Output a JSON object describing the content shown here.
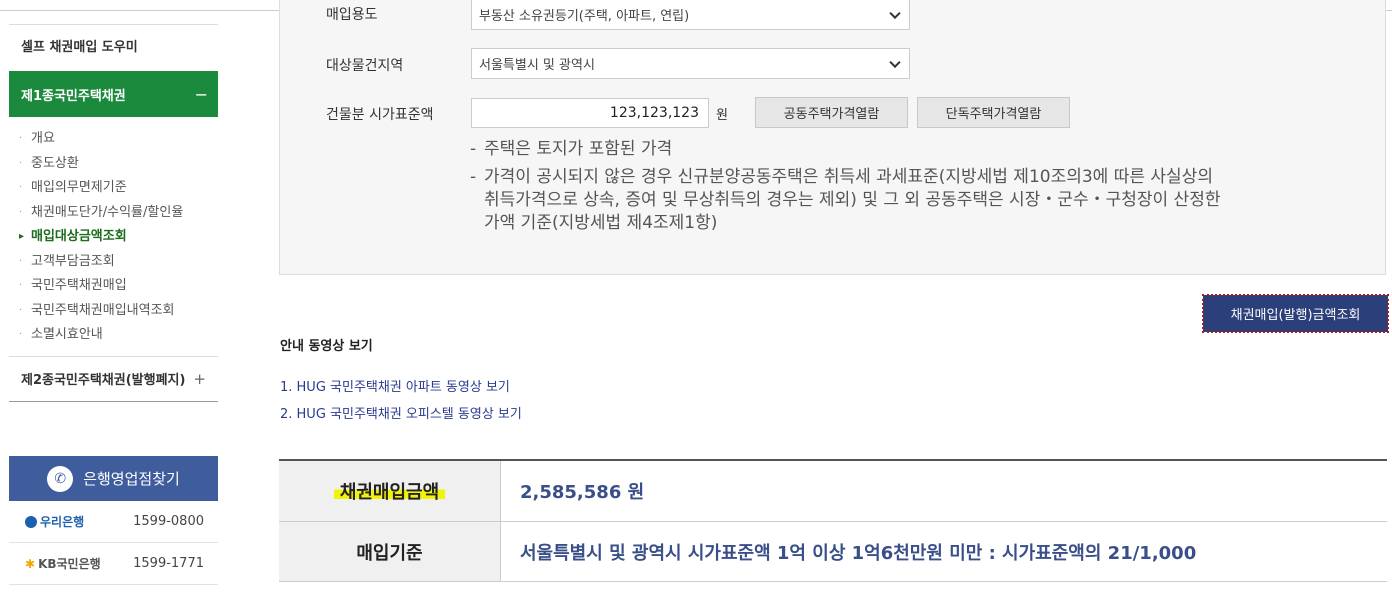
{
  "sidebar": {
    "title": "셀프 채권매입 도우미",
    "active_section": "제1종국민주택채권",
    "active_toggle": "−",
    "items": [
      {
        "label": "개요",
        "current": false
      },
      {
        "label": "중도상환",
        "current": false
      },
      {
        "label": "매입의무면제기준",
        "current": false
      },
      {
        "label": "채권매도단가/수익률/할인율",
        "current": false
      },
      {
        "label": "매입대상금액조회",
        "current": true
      },
      {
        "label": "고객부담금조회",
        "current": false
      },
      {
        "label": "국민주택채권매입",
        "current": false
      },
      {
        "label": "국민주택채권매입내역조회",
        "current": false
      },
      {
        "label": "소멸시효안내",
        "current": false
      }
    ],
    "second_section": "제2종국민주택채권(발행폐지)",
    "second_toggle": "+"
  },
  "branch_finder": {
    "title": "은행영업점찾기",
    "banks": [
      {
        "name": "우리은행",
        "phone": "1599-0800"
      },
      {
        "name": "KB국민은행",
        "phone": "1599-1771"
      }
    ]
  },
  "form": {
    "purpose_label": "매입용도",
    "purpose_value": "부동산 소유권등기(주택, 아파트, 연립)",
    "region_label": "대상물건지역",
    "region_value": "서울특별시 및 광역시",
    "price_label": "건물분 시가표준액",
    "price_value": "123,123,123",
    "price_unit": "원",
    "apt_price_button": "공동주택가격열람",
    "house_price_button": "단독주택가격열람",
    "notes": [
      "주택은 토지가 포함된 가격",
      "가격이 공시되지 않은 경우 신규분양공동주택은 취득세 과세표준(지방세법 제10조의3에 따른 사실상의",
      "취득가격으로 상속, 증여 및 무상취득의 경우는 제외) 및 그 외 공동주택은 시장・군수・구청장이 산정한",
      "가액 기준(지방세법 제4조제1항)"
    ],
    "note_dash": "-"
  },
  "search_button": "채권매입(발행)금액조회",
  "video": {
    "title": "안내 동영상 보기",
    "links": [
      "1. HUG 국민주택채권 아파트 동영상 보기",
      "2. HUG 국민주택채권 오피스텔 동영상 보기"
    ]
  },
  "result": {
    "amount_label": "채권매입금액",
    "amount_value": "2,585,586 원",
    "basis_label": "매입기준",
    "basis_value": "서울특별시 및 광역시 시가표준액 1억 이상 1억6천만원 미만 : 시가표준액의 21/1,000"
  },
  "colors": {
    "green": "#1b8a3c",
    "navy": "#2b3f7a",
    "branch_blue": "#3f5d9d",
    "result_text": "#3a4f8a",
    "highlight": "#f2f20a"
  }
}
